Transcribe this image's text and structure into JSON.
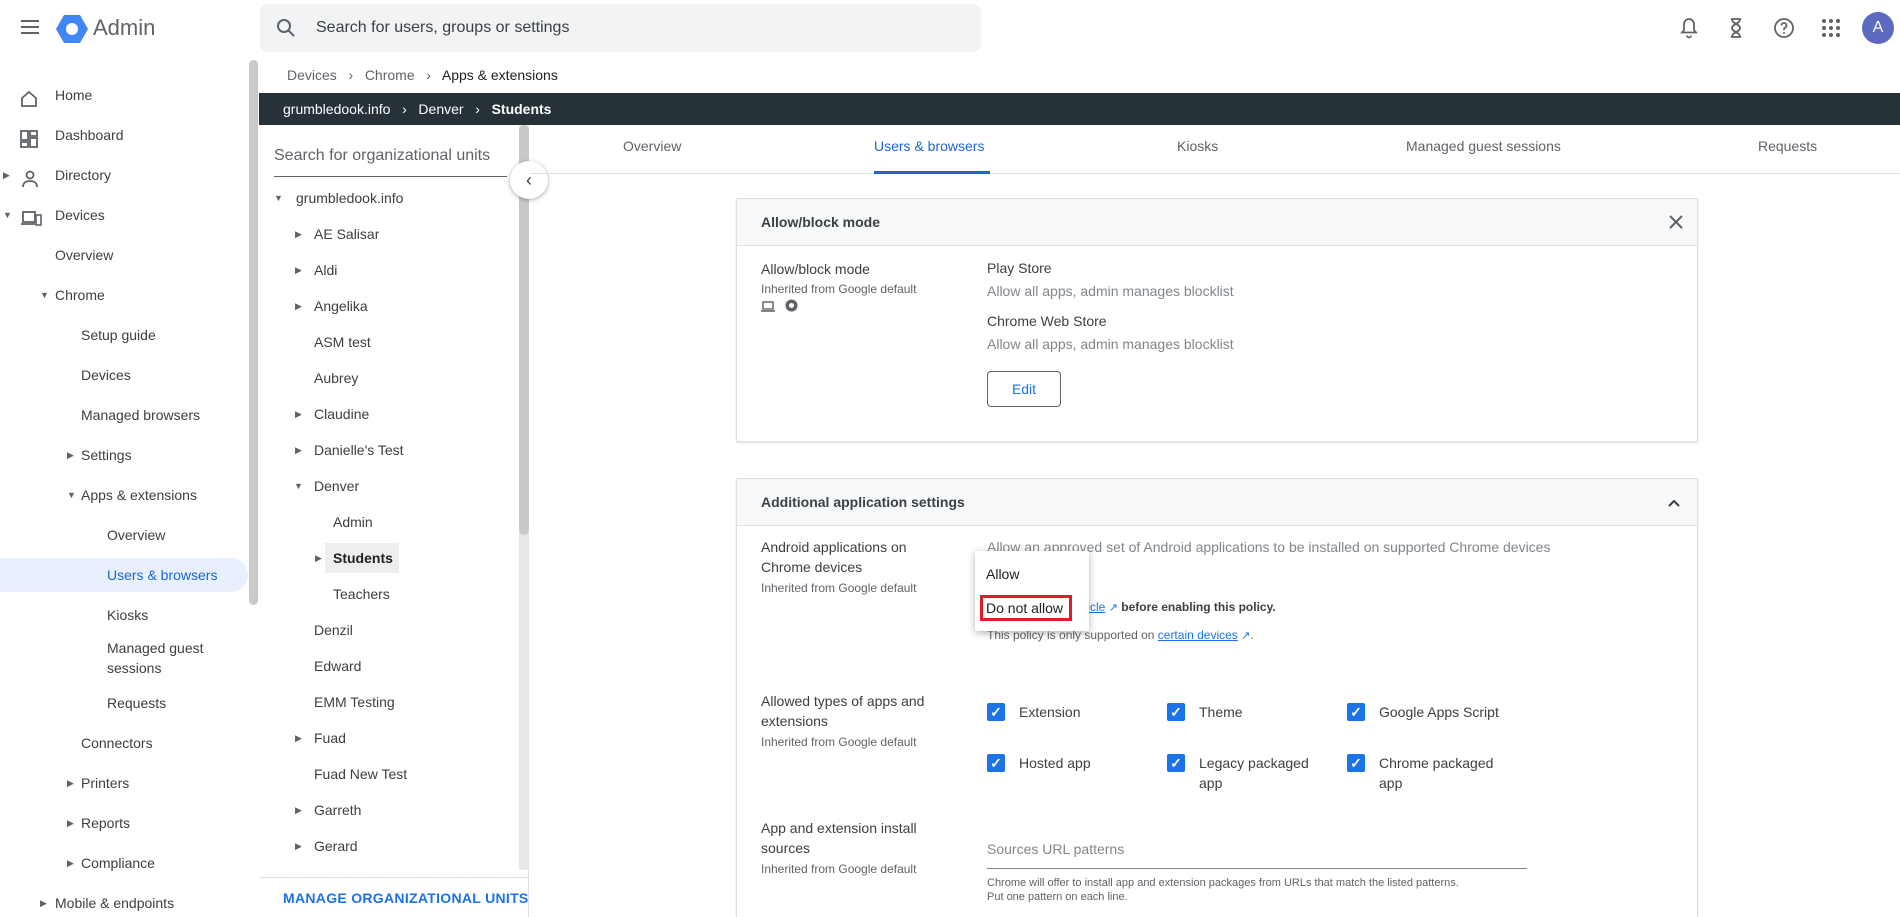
{
  "header": {
    "app_title": "Admin",
    "search_placeholder": "Search for users, groups or settings",
    "avatar_letter": "A",
    "accent_color": "#1a73e8"
  },
  "nav": {
    "items": [
      {
        "label": "Home"
      },
      {
        "label": "Dashboard"
      },
      {
        "label": "Directory"
      },
      {
        "label": "Devices"
      },
      {
        "label": "Overview"
      },
      {
        "label": "Chrome"
      },
      {
        "label": "Setup guide"
      },
      {
        "label": "Devices"
      },
      {
        "label": "Managed browsers"
      },
      {
        "label": "Settings"
      },
      {
        "label": "Apps & extensions"
      },
      {
        "label": "Overview"
      },
      {
        "label": "Users & browsers"
      },
      {
        "label": "Kiosks"
      },
      {
        "label": "Managed guest sessions"
      },
      {
        "label": "Requests"
      },
      {
        "label": "Connectors"
      },
      {
        "label": "Printers"
      },
      {
        "label": "Reports"
      },
      {
        "label": "Compliance"
      },
      {
        "label": "Mobile & endpoints"
      }
    ]
  },
  "breadcrumb": {
    "items": [
      "Devices",
      "Chrome",
      "Apps & extensions"
    ]
  },
  "org_path": {
    "items": [
      "grumbledook.info",
      "Denver",
      "Students"
    ]
  },
  "ou_panel": {
    "search_placeholder": "Search for organizational units",
    "root": "grumbledook.info",
    "items": [
      "AE Salisar",
      "Aldi",
      "Angelika",
      "ASM test",
      "Aubrey",
      "Claudine",
      "Danielle's Test",
      "Denver",
      "Admin",
      "Students",
      "Teachers",
      "Denzil",
      "Edward",
      "EMM Testing",
      "Fuad",
      "Fuad New Test",
      "Garreth",
      "Gerard"
    ],
    "manage_label": "MANAGE ORGANIZATIONAL UNITS"
  },
  "tabs": [
    "Overview",
    "Users & browsers",
    "Kiosks",
    "Managed guest sessions",
    "Requests"
  ],
  "allow_block": {
    "header": "Allow/block mode",
    "label": "Allow/block mode",
    "inherited": "Inherited from Google default",
    "play_store": "Play Store",
    "play_store_value": "Allow all apps, admin manages blocklist",
    "web_store": "Chrome Web Store",
    "web_store_value": "Allow all apps, admin manages blocklist",
    "edit_label": "Edit"
  },
  "additional": {
    "header": "Additional application settings",
    "android": {
      "label": "Android applications on Chrome devices",
      "inherited": "Inherited from Google default",
      "description": "Allow an approved set of Android applications to be installed on supported Chrome devices",
      "article_link": "ticle",
      "article_suffix": "before enabling this policy.",
      "support_prefix": "This policy is only supported on",
      "support_link": "certain devices"
    },
    "dropdown": {
      "options": [
        "Allow",
        "Do not allow"
      ]
    },
    "types": {
      "label": "Allowed types of apps and extensions",
      "inherited": "Inherited from Google default",
      "options": [
        "Extension",
        "Theme",
        "Google Apps Script",
        "Hosted app",
        "Legacy packaged app",
        "Chrome packaged app"
      ]
    },
    "sources": {
      "label": "App and extension install sources",
      "inherited": "Inherited from Google default",
      "placeholder": "Sources URL patterns",
      "help": "Chrome will offer to install app and extension packages from URLs that match the listed patterns. Put one pattern on each line."
    }
  }
}
